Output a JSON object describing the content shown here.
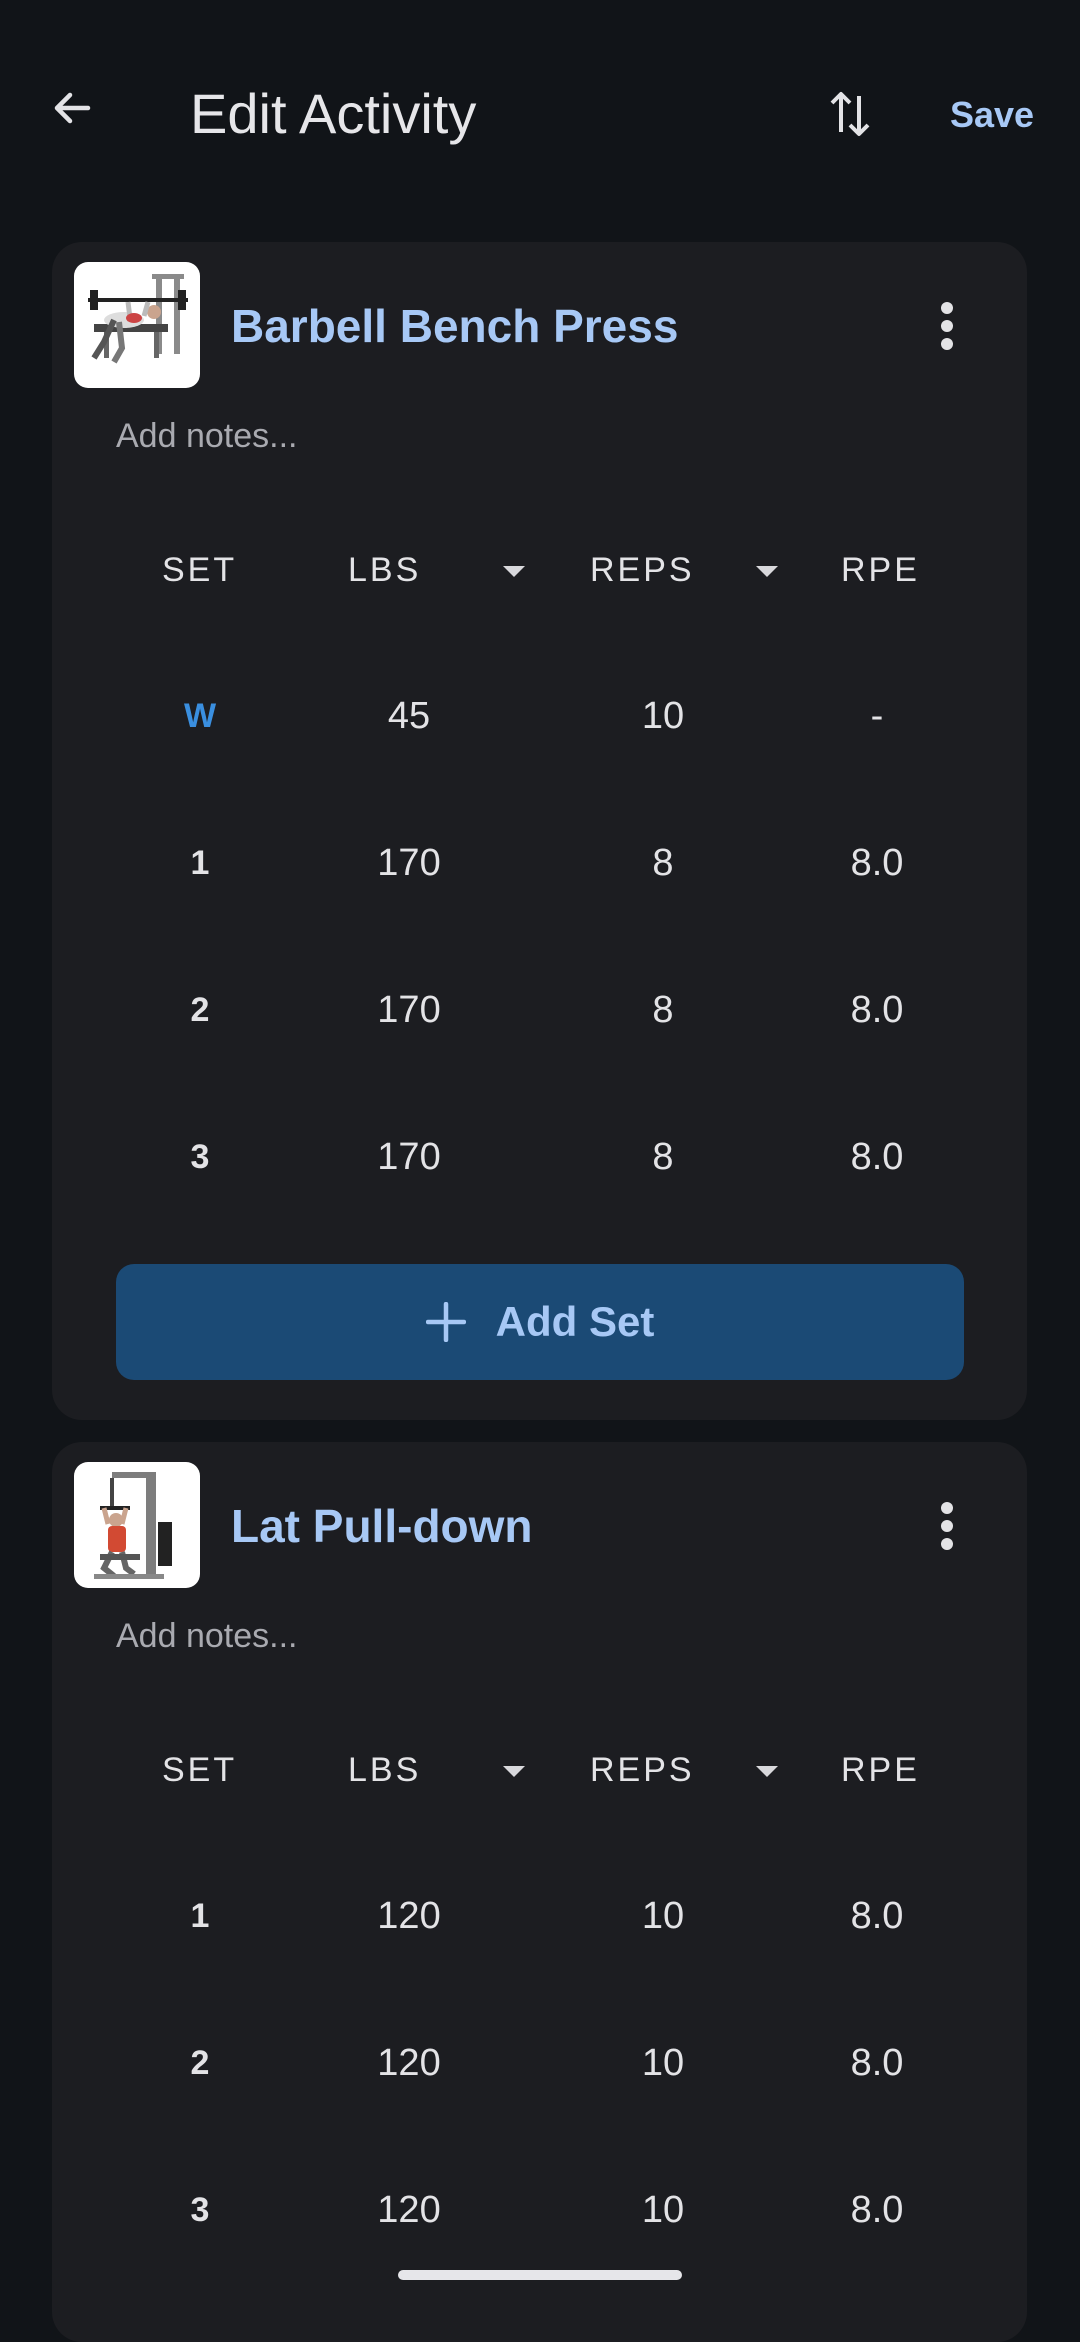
{
  "header": {
    "title": "Edit Activity",
    "back_icon": "arrow-back-icon",
    "sort_icon": "swap-vert-icon",
    "save_label": "Save"
  },
  "exercises": [
    {
      "name": "Barbell Bench Press",
      "thumbnail": "bench-press-image",
      "notes_placeholder": "Add notes...",
      "columns": {
        "set": "SET",
        "weight": "LBS",
        "reps": "REPS",
        "rpe": "RPE"
      },
      "sets": [
        {
          "set": "W",
          "weight": "45",
          "reps": "10",
          "rpe": "-"
        },
        {
          "set": "1",
          "weight": "170",
          "reps": "8",
          "rpe": "8.0"
        },
        {
          "set": "2",
          "weight": "170",
          "reps": "8",
          "rpe": "8.0"
        },
        {
          "set": "3",
          "weight": "170",
          "reps": "8",
          "rpe": "8.0"
        }
      ],
      "add_set_label": "Add Set"
    },
    {
      "name": "Lat Pull-down",
      "thumbnail": "lat-pulldown-image",
      "notes_placeholder": "Add notes...",
      "columns": {
        "set": "SET",
        "weight": "LBS",
        "reps": "REPS",
        "rpe": "RPE"
      },
      "sets": [
        {
          "set": "1",
          "weight": "120",
          "reps": "10",
          "rpe": "8.0"
        },
        {
          "set": "2",
          "weight": "120",
          "reps": "10",
          "rpe": "8.0"
        },
        {
          "set": "3",
          "weight": "120",
          "reps": "10",
          "rpe": "8.0"
        }
      ]
    }
  ],
  "colors": {
    "background": "#111418",
    "card": "#1c1d21",
    "accent": "#a7c8f5",
    "warmup": "#3a8fe0",
    "add_button": "#1b4a75"
  }
}
